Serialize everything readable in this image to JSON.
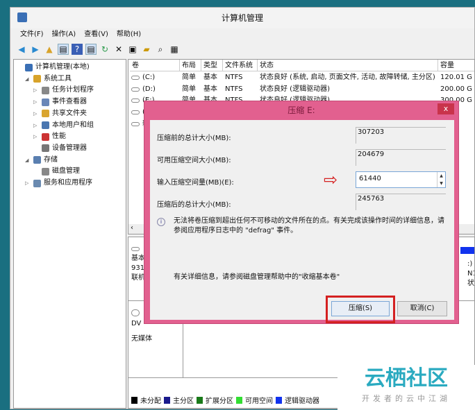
{
  "window": {
    "title": "计算机管理"
  },
  "menu": [
    "文件(F)",
    "操作(A)",
    "查看(V)",
    "帮助(H)"
  ],
  "toolbar_icons": [
    "back-icon",
    "forward-icon",
    "up-folder-icon",
    "console-tree-icon",
    "help-icon",
    "action-pane-icon",
    "refresh-icon",
    "delete-icon",
    "properties-icon",
    "open-icon",
    "search-icon",
    "settings-icon"
  ],
  "tree": [
    {
      "label": "计算机管理(本地)",
      "level": 0,
      "color": "#3a6fb5"
    },
    {
      "label": "系统工具",
      "level": 1,
      "color": "#d8a32a",
      "expander": "◢"
    },
    {
      "label": "任务计划程序",
      "level": 2,
      "color": "#888",
      "expander": "▷"
    },
    {
      "label": "事件查看器",
      "level": 2,
      "color": "#6a87b8",
      "expander": "▷"
    },
    {
      "label": "共享文件夹",
      "level": 2,
      "color": "#d9a530",
      "expander": "▷"
    },
    {
      "label": "本地用户和组",
      "level": 2,
      "color": "#4a76b0",
      "expander": "▷"
    },
    {
      "label": "性能",
      "level": 2,
      "color": "#c33",
      "expander": "▷"
    },
    {
      "label": "设备管理器",
      "level": 2,
      "color": "#777"
    },
    {
      "label": "存储",
      "level": 1,
      "color": "#5a7fb0",
      "expander": "◢"
    },
    {
      "label": "磁盘管理",
      "level": 2,
      "color": "#888"
    },
    {
      "label": "服务和应用程序",
      "level": 1,
      "color": "#6a8ab0",
      "expander": "▷"
    }
  ],
  "volumes": {
    "headers": [
      "卷",
      "布局",
      "类型",
      "文件系统",
      "状态",
      "容量"
    ],
    "rows": [
      [
        "(C:)",
        "简单",
        "基本",
        "NTFS",
        "状态良好 (系统, 启动, 页面文件, 活动, 故障转储, 主分区)",
        "120.01 G"
      ],
      [
        "(D:)",
        "简单",
        "基本",
        "NTFS",
        "状态良好 (逻辑驱动器)",
        "200.00 G"
      ],
      [
        "(E:)",
        "简单",
        "基本",
        "NTFS",
        "状态良好 (逻辑驱动器)",
        "300.00 G"
      ],
      [
        "(",
        "",
        "",
        "",
        "",
        "G"
      ],
      [
        "新",
        "",
        "",
        "",
        "",
        "GB"
      ]
    ]
  },
  "bottom": {
    "disk_lines": [
      "基本",
      "931",
      "联机"
    ],
    "right_lines": [
      ":)",
      "N1",
      "状"
    ],
    "dvd": "DV",
    "no_media": "无媒体"
  },
  "legend": [
    {
      "label": "未分配",
      "color": "#000000"
    },
    {
      "label": "主分区",
      "color": "#1a1a8c"
    },
    {
      "label": "扩展分区",
      "color": "#1a7a1a"
    },
    {
      "label": "可用空间",
      "color": "#33dd33"
    },
    {
      "label": "逻辑驱动器",
      "color": "#1133ee"
    }
  ],
  "dialog": {
    "title": "压缩 E:",
    "close": "x",
    "fields": [
      {
        "label": "压缩前的总计大小(MB):",
        "value": "307203"
      },
      {
        "label": "可用压缩空间大小(MB):",
        "value": "204679"
      },
      {
        "label": "输入压缩空间量(MB)(E):",
        "value": "61440"
      },
      {
        "label": "压缩后的总计大小(MB):",
        "value": "245763"
      }
    ],
    "info": "无法将卷压缩到超出任何不可移动的文件所在的点。有关完成该操作时间的详细信息，请参阅应用程序日志中的 \"defrag\" 事件。",
    "help": "有关详细信息，请参阅磁盘管理帮助中的\"收缩基本卷\"",
    "shrink_button": "压缩(S)",
    "cancel_button": "取消(C)"
  },
  "watermark": {
    "title": "云栖社区",
    "subtitle": "开发者的云中江湖"
  },
  "colors": {
    "dialog_border": "#e2608f",
    "highlight": "#d42020",
    "desktop": "#1a6f80"
  }
}
